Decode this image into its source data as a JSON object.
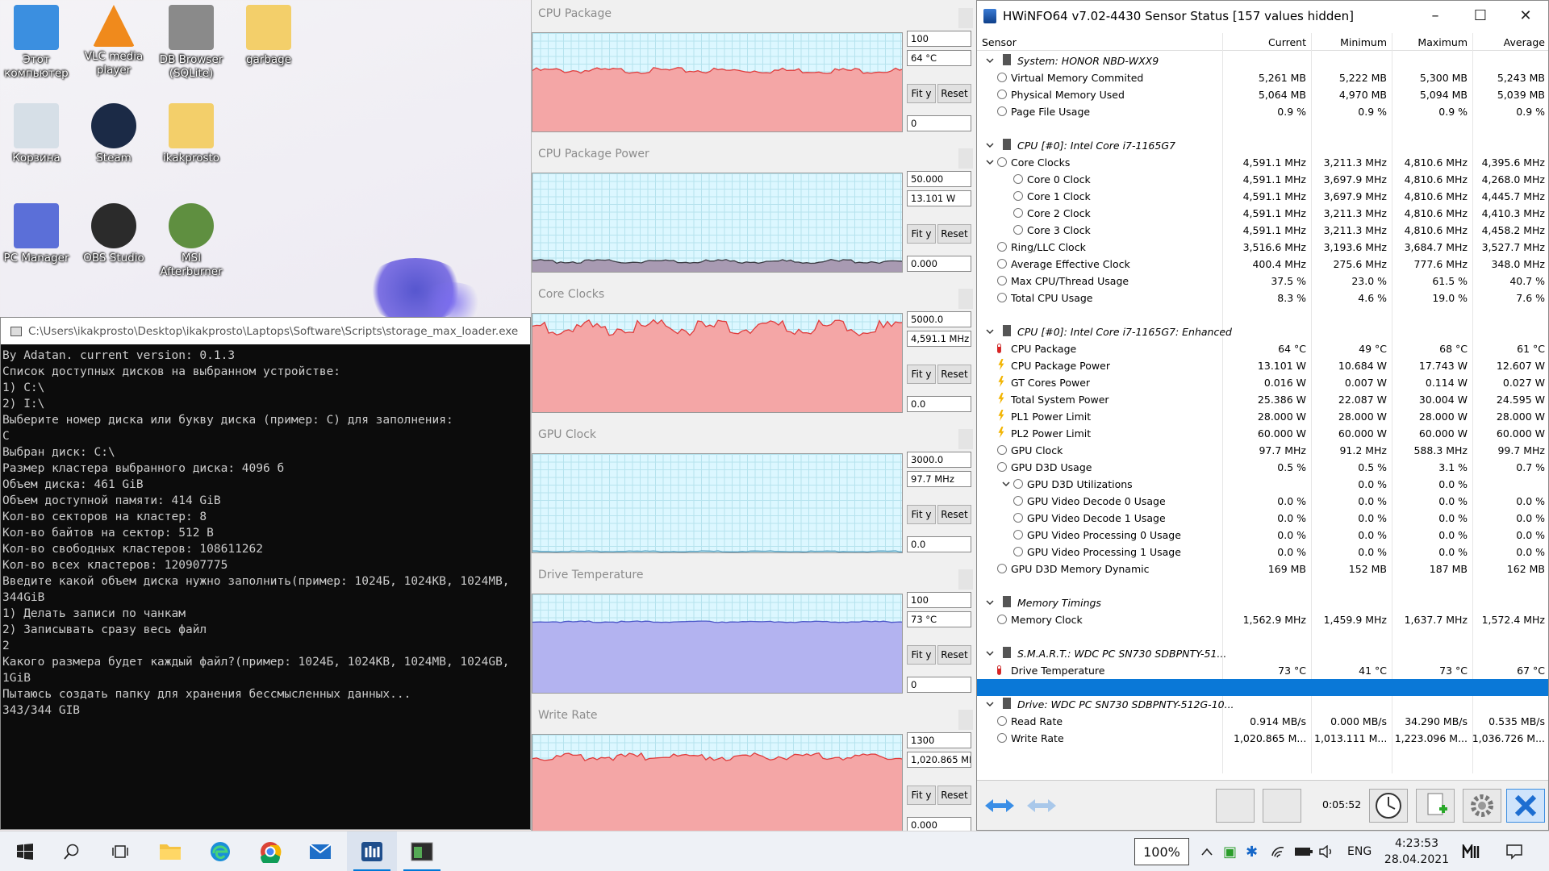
{
  "desktop": {
    "icons": [
      {
        "label": "Этот компьютер",
        "icon": "pc-icon"
      },
      {
        "label": "VLC media player",
        "icon": "vlc-icon"
      },
      {
        "label": "DB Browser (SQLite)",
        "icon": "db-icon"
      },
      {
        "label": "garbage",
        "icon": "folder-icon"
      },
      {
        "label": "Корзина",
        "icon": "recycle-bin-icon"
      },
      {
        "label": "Steam",
        "icon": "steam-icon"
      },
      {
        "label": "ikakprosto",
        "icon": "folder-icon"
      },
      {
        "label": "PC Manager",
        "icon": "pc-manager-icon"
      },
      {
        "label": "OBS Studio",
        "icon": "obs-icon"
      },
      {
        "label": "MSI Afterburner",
        "icon": "msi-icon"
      }
    ]
  },
  "console": {
    "title": "C:\\Users\\ikakprosto\\Desktop\\ikakprosto\\Laptops\\Software\\Scripts\\storage_max_loader.exe",
    "lines": [
      "By Adatan. current version: 0.1.3",
      "Список доступных дисков на выбранном устройстве:",
      "1) C:\\",
      "2) I:\\",
      "Выберите номер диска или букву диска (пример: C) для заполнения:",
      "C",
      "Выбран диск: C:\\",
      "Размер кластера выбранного диска: 4096 б",
      "Объем диска: 461 GiB",
      "Объем доступной памяти: 414 GiB",
      "Кол-во секторов на кластер: 8",
      "Кол-во байтов на сектор: 512 B",
      "Кол-во свободных кластеров: 108611262",
      "Кол-во всех кластеров: 120907775",
      "Введите какой объем диска нужно заполнить(пример: 1024Б, 1024KB, 1024MB,",
      "344GiB",
      "1) Делать записи по чанкам",
      "2) Записывать сразу весь файл",
      "2",
      "Какого размера будет каждый файл?(пример: 1024Б, 1024KB, 1024MB, 1024GB,",
      "1GiB",
      "Пытаюсь создать папку для хранения бессмысленных данных...",
      "343/344 GIB"
    ]
  },
  "graphs": [
    {
      "title": "CPU Package",
      "max": "100",
      "current": "64 °C",
      "min": "0",
      "fill": "#f4a6a6",
      "line": "#e03c3c",
      "level": 0.64,
      "noise": 0.015
    },
    {
      "title": "CPU Package Power",
      "max": "50.000",
      "current": "13.101 W",
      "min": "0.000",
      "fill": "#a89ab2",
      "line": "#3c3c44",
      "level": 0.13,
      "noise": 0.01
    },
    {
      "title": "Core Clocks",
      "max": "5000.0",
      "current": "4,591.1 MHz",
      "min": "0.0",
      "fill": "#f4a6a6",
      "line": "#e03c3c",
      "level": 0.9,
      "noise": 0.04
    },
    {
      "title": "GPU Clock",
      "max": "3000.0",
      "current": "97.7 MHz",
      "min": "0.0",
      "fill": "#bfe6f0",
      "line": "#5aa0c0",
      "level": 0.03,
      "noise": 0.003
    },
    {
      "title": "Drive Temperature",
      "max": "100",
      "current": "73 °C",
      "min": "0",
      "fill": "#b3b3f0",
      "line": "#4a56c8",
      "level": 0.73,
      "noise": 0.004
    },
    {
      "title": "Write Rate",
      "max": "1300",
      "current": "1,020.865 MI",
      "min": "0.000",
      "fill": "#f4a6a6",
      "line": "#e03c3c",
      "level": 0.8,
      "noise": 0.02
    }
  ],
  "graph_buttons": {
    "fit": "Fit y",
    "reset": "Reset"
  },
  "hwinfo": {
    "title": "HWiNFO64 v7.02-4430 Sensor Status [157 values hidden]",
    "columns": [
      "Sensor",
      "Current",
      "Minimum",
      "Maximum",
      "Average"
    ],
    "rows": [
      {
        "type": "group",
        "name": "System: HONOR NBD-WXX9"
      },
      {
        "type": "item",
        "icon": "clk",
        "name": "Virtual Memory Commited",
        "cur": "5,261 MB",
        "min": "5,222 MB",
        "max": "5,300 MB",
        "avg": "5,243 MB"
      },
      {
        "type": "item",
        "icon": "clk",
        "name": "Physical Memory Used",
        "cur": "5,064 MB",
        "min": "4,970 MB",
        "max": "5,094 MB",
        "avg": "5,039 MB"
      },
      {
        "type": "item",
        "icon": "clk",
        "name": "Page File Usage",
        "cur": "0.9 %",
        "min": "0.9 %",
        "max": "0.9 %",
        "avg": "0.9 %"
      },
      {
        "type": "blank"
      },
      {
        "type": "group",
        "name": "CPU [#0]: Intel Core i7-1165G7"
      },
      {
        "type": "item",
        "icon": "clk",
        "exp": true,
        "name": "Core Clocks",
        "cur": "4,591.1 MHz",
        "min": "3,211.3 MHz",
        "max": "4,810.6 MHz",
        "avg": "4,395.6 MHz"
      },
      {
        "type": "item",
        "icon": "clk",
        "indent": true,
        "name": "Core 0 Clock",
        "cur": "4,591.1 MHz",
        "min": "3,697.9 MHz",
        "max": "4,810.6 MHz",
        "avg": "4,268.0 MHz"
      },
      {
        "type": "item",
        "icon": "clk",
        "indent": true,
        "name": "Core 1 Clock",
        "cur": "4,591.1 MHz",
        "min": "3,697.9 MHz",
        "max": "4,810.6 MHz",
        "avg": "4,445.7 MHz"
      },
      {
        "type": "item",
        "icon": "clk",
        "indent": true,
        "name": "Core 2 Clock",
        "cur": "4,591.1 MHz",
        "min": "3,211.3 MHz",
        "max": "4,810.6 MHz",
        "avg": "4,410.3 MHz"
      },
      {
        "type": "item",
        "icon": "clk",
        "indent": true,
        "name": "Core 3 Clock",
        "cur": "4,591.1 MHz",
        "min": "3,211.3 MHz",
        "max": "4,810.6 MHz",
        "avg": "4,458.2 MHz"
      },
      {
        "type": "item",
        "icon": "clk",
        "name": "Ring/LLC Clock",
        "cur": "3,516.6 MHz",
        "min": "3,193.6 MHz",
        "max": "3,684.7 MHz",
        "avg": "3,527.7 MHz"
      },
      {
        "type": "item",
        "icon": "clk",
        "name": "Average Effective Clock",
        "cur": "400.4 MHz",
        "min": "275.6 MHz",
        "max": "777.6 MHz",
        "avg": "348.0 MHz"
      },
      {
        "type": "item",
        "icon": "clk",
        "name": "Max CPU/Thread Usage",
        "cur": "37.5 %",
        "min": "23.0 %",
        "max": "61.5 %",
        "avg": "40.7 %"
      },
      {
        "type": "item",
        "icon": "clk",
        "name": "Total CPU Usage",
        "cur": "8.3 %",
        "min": "4.6 %",
        "max": "19.0 %",
        "avg": "7.6 %"
      },
      {
        "type": "blank"
      },
      {
        "type": "group",
        "name": "CPU [#0]: Intel Core i7-1165G7: Enhanced"
      },
      {
        "type": "item",
        "icon": "therm",
        "name": "CPU Package",
        "cur": "64 °C",
        "min": "49 °C",
        "max": "68 °C",
        "avg": "61 °C"
      },
      {
        "type": "item",
        "icon": "bolt",
        "name": "CPU Package Power",
        "cur": "13.101 W",
        "min": "10.684 W",
        "max": "17.743 W",
        "avg": "12.607 W"
      },
      {
        "type": "item",
        "icon": "bolt",
        "name": "GT Cores Power",
        "cur": "0.016 W",
        "min": "0.007 W",
        "max": "0.114 W",
        "avg": "0.027 W"
      },
      {
        "type": "item",
        "icon": "bolt",
        "name": "Total System Power",
        "cur": "25.386 W",
        "min": "22.087 W",
        "max": "30.004 W",
        "avg": "24.595 W"
      },
      {
        "type": "item",
        "icon": "bolt",
        "name": "PL1 Power Limit",
        "cur": "28.000 W",
        "min": "28.000 W",
        "max": "28.000 W",
        "avg": "28.000 W"
      },
      {
        "type": "item",
        "icon": "bolt",
        "name": "PL2 Power Limit",
        "cur": "60.000 W",
        "min": "60.000 W",
        "max": "60.000 W",
        "avg": "60.000 W"
      },
      {
        "type": "item",
        "icon": "clk",
        "name": "GPU Clock",
        "cur": "97.7 MHz",
        "min": "91.2 MHz",
        "max": "588.3 MHz",
        "avg": "99.7 MHz"
      },
      {
        "type": "item",
        "icon": "clk",
        "name": "GPU D3D Usage",
        "cur": "0.5 %",
        "min": "0.5 %",
        "max": "3.1 %",
        "avg": "0.7 %"
      },
      {
        "type": "item",
        "icon": "clk",
        "exp": true,
        "indent": true,
        "name": "GPU D3D Utilizations",
        "cur": "",
        "min": "0.0 %",
        "max": "0.0 %",
        "avg": ""
      },
      {
        "type": "item",
        "icon": "clk",
        "indent": true,
        "name": "GPU Video Decode 0 Usage",
        "cur": "0.0 %",
        "min": "0.0 %",
        "max": "0.0 %",
        "avg": "0.0 %"
      },
      {
        "type": "item",
        "icon": "clk",
        "indent": true,
        "name": "GPU Video Decode 1 Usage",
        "cur": "0.0 %",
        "min": "0.0 %",
        "max": "0.0 %",
        "avg": "0.0 %"
      },
      {
        "type": "item",
        "icon": "clk",
        "indent": true,
        "name": "GPU Video Processing 0 Usage",
        "cur": "0.0 %",
        "min": "0.0 %",
        "max": "0.0 %",
        "avg": "0.0 %"
      },
      {
        "type": "item",
        "icon": "clk",
        "indent": true,
        "name": "GPU Video Processing 1 Usage",
        "cur": "0.0 %",
        "min": "0.0 %",
        "max": "0.0 %",
        "avg": "0.0 %"
      },
      {
        "type": "item",
        "icon": "clk",
        "name": "GPU D3D Memory Dynamic",
        "cur": "169 MB",
        "min": "152 MB",
        "max": "187 MB",
        "avg": "162 MB"
      },
      {
        "type": "blank"
      },
      {
        "type": "group",
        "name": "Memory Timings"
      },
      {
        "type": "item",
        "icon": "clk",
        "name": "Memory Clock",
        "cur": "1,562.9 MHz",
        "min": "1,459.9 MHz",
        "max": "1,637.7 MHz",
        "avg": "1,572.4 MHz"
      },
      {
        "type": "blank"
      },
      {
        "type": "group",
        "name": "S.M.A.R.T.: WDC PC SN730 SDBPNTY-51..."
      },
      {
        "type": "item",
        "icon": "therm",
        "name": "Drive Temperature",
        "cur": "73 °C",
        "min": "41 °C",
        "max": "73 °C",
        "avg": "67 °C"
      },
      {
        "type": "selected"
      },
      {
        "type": "group",
        "name": "Drive: WDC PC SN730 SDBPNTY-512G-10..."
      },
      {
        "type": "item",
        "icon": "clk",
        "name": "Read Rate",
        "cur": "0.914 MB/s",
        "min": "0.000 MB/s",
        "max": "34.290 MB/s",
        "avg": "0.535 MB/s"
      },
      {
        "type": "item",
        "icon": "clk",
        "name": "Write Rate",
        "cur": "1,020.865 M...",
        "min": "1,013.111 M...",
        "max": "1,223.096 M...",
        "avg": "1,036.726 M..."
      }
    ],
    "timer": "0:05:52"
  },
  "taskbar": {
    "battery": "100%",
    "lang": "ENG",
    "time": "4:23:53",
    "date": "28.04.2021"
  }
}
